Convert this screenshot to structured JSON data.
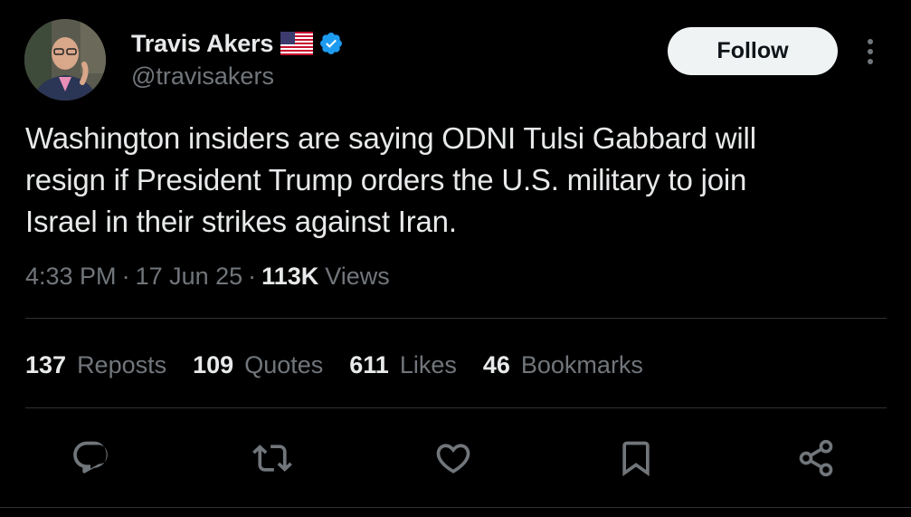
{
  "author": {
    "display_name": "Travis Akers",
    "handle": "@travisakers",
    "flag_icon": "us-flag-icon",
    "verified_icon": "verified-badge-icon",
    "verified_color": "#1d9bf0"
  },
  "follow_button": {
    "label": "Follow"
  },
  "tweet": {
    "text": "Washington insiders are saying ODNI Tulsi Gabbard will\nresign if President Trump orders the U.S. military to join\nIsrael in their strikes against Iran."
  },
  "meta": {
    "time": "4:33 PM",
    "separator": "·",
    "date": "17 Jun 25",
    "views_count": "113K",
    "views_label": "Views"
  },
  "stats": [
    {
      "count": "137",
      "label": "Reposts"
    },
    {
      "count": "109",
      "label": "Quotes"
    },
    {
      "count": "611",
      "label": "Likes"
    },
    {
      "count": "46",
      "label": "Bookmarks"
    }
  ],
  "actions": [
    {
      "icon": "reply-icon"
    },
    {
      "icon": "repost-icon"
    },
    {
      "icon": "like-icon"
    },
    {
      "icon": "bookmark-icon"
    },
    {
      "icon": "share-icon"
    }
  ],
  "colors": {
    "background": "#000000",
    "primary_text": "#e7e9ea",
    "secondary_text": "#71767b",
    "divider": "#2f3336",
    "follow_bg": "#eff3f4"
  }
}
